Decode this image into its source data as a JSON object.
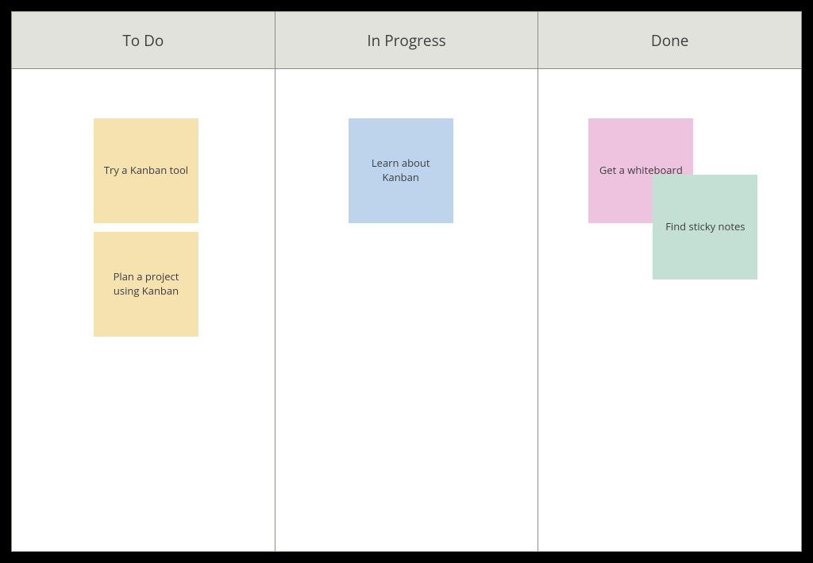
{
  "columns": [
    {
      "id": "todo",
      "title": "To Do"
    },
    {
      "id": "inprogress",
      "title": "In Progress"
    },
    {
      "id": "done",
      "title": "Done"
    }
  ],
  "cards": {
    "todo_1": {
      "text": "Try a Kanban tool",
      "color": "yellow"
    },
    "todo_2": {
      "text": "Plan a project using Kanban",
      "color": "yellow"
    },
    "inprogress_1": {
      "text": "Learn about Kanban",
      "color": "blue"
    },
    "done_1": {
      "text": "Get a whiteboard",
      "color": "pink"
    },
    "done_2": {
      "text": "Find sticky notes",
      "color": "green"
    }
  }
}
